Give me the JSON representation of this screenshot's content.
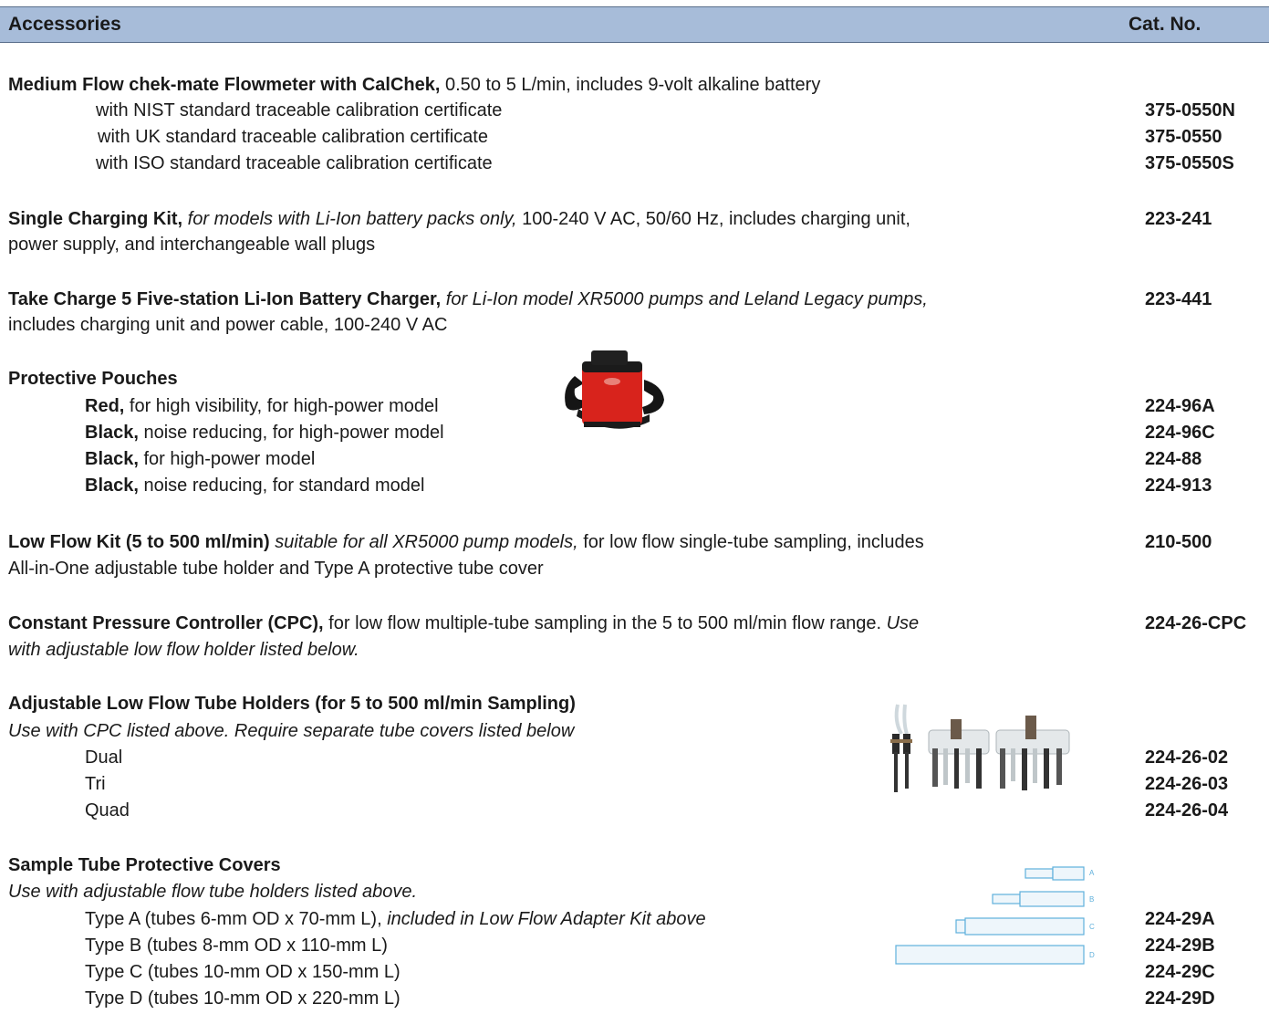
{
  "header": {
    "title": "Accessories",
    "cat_label": "Cat. No."
  },
  "flowmeter": {
    "name": "Medium Flow chek-mate Flowmeter with CalChek,",
    "desc": " 0.50 to 5 L/min, includes 9-volt alkaline battery",
    "items": [
      {
        "label": "with NIST standard traceable calibration certificate",
        "cat": "375-0550N"
      },
      {
        "label": "with UK standard traceable calibration certificate",
        "cat": "375-0550"
      },
      {
        "label": "with ISO standard traceable calibration certificate",
        "cat": "375-0550S"
      }
    ]
  },
  "single_charging": {
    "name": "Single Charging Kit,",
    "italic": " for models with Li-Ion battery packs only,",
    "desc": " 100-240 V AC, 50/60 Hz, includes charging unit,",
    "line2": "power supply, and interchangeable wall plugs",
    "cat": "223-241"
  },
  "take_charge": {
    "name": "Take Charge 5 Five-station Li-Ion Battery Charger,",
    "italic": " for Li-Ion model XR5000 pumps and Leland Legacy pumps,",
    "line2": "includes charging unit and power cable, 100-240 V AC",
    "cat": "223-441"
  },
  "pouches": {
    "title": "Protective Pouches",
    "items": [
      {
        "bold": "Red,",
        "text": " for high visibility, for high-power model",
        "cat": "224-96A"
      },
      {
        "bold": "Black,",
        "text": " noise reducing, for high-power model",
        "cat": "224-96C"
      },
      {
        "bold": "Black,",
        "text": " for high-power model",
        "cat": "224-88"
      },
      {
        "bold": "Black,",
        "text": " noise reducing, for standard model",
        "cat": "224-913"
      }
    ]
  },
  "low_flow_kit": {
    "name": "Low Flow Kit (5 to 500 ml/min)",
    "italic": " suitable for all XR5000 pump models,",
    "desc": " for low flow single-tube sampling, includes",
    "line2": "All-in-One adjustable tube holder and Type A protective tube cover",
    "cat": "210-500"
  },
  "cpc": {
    "name": "Constant Pressure Controller (CPC),",
    "desc": " for low flow multiple-tube sampling in the 5 to 500 ml/min flow range.",
    "italic": " Use",
    "line2": "with adjustable low flow holder listed below.",
    "cat": "224-26-CPC"
  },
  "holders": {
    "title": "Adjustable Low Flow Tube Holders (for 5 to 500 ml/min Sampling)",
    "subtitle": "Use with CPC listed above. Require separate tube covers listed below",
    "items": [
      {
        "label": "Dual",
        "cat": "224-26-02"
      },
      {
        "label": "Tri",
        "cat": "224-26-03"
      },
      {
        "label": "Quad",
        "cat": "224-26-04"
      }
    ]
  },
  "covers": {
    "title": "Sample Tube Protective Covers",
    "subtitle": "Use with adjustable flow tube holders listed above.",
    "item_a": {
      "label": "Type A (tubes 6-mm OD x 70-mm L),",
      "italic": " included in Low Flow Adapter Kit above",
      "cat": "224-29A"
    },
    "items": [
      {
        "label": "Type B (tubes 8-mm OD x 110-mm L)",
        "cat": "224-29B"
      },
      {
        "label": "Type C (tubes 10-mm OD x 150-mm L)",
        "cat": "224-29C"
      },
      {
        "label": "Type D (tubes 10-mm OD x 220-mm L)",
        "cat": "224-29D"
      }
    ],
    "tube_letters": [
      "A",
      "B",
      "C",
      "D"
    ]
  },
  "colors": {
    "header_bg": "#a7bcd9",
    "pouch_red": "#d8231c",
    "tube_outline": "#5fb0dc"
  },
  "icons": {
    "pouch": "pouch-photo",
    "holders": "tube-holders-photo",
    "covers": "tube-covers-diagram"
  }
}
